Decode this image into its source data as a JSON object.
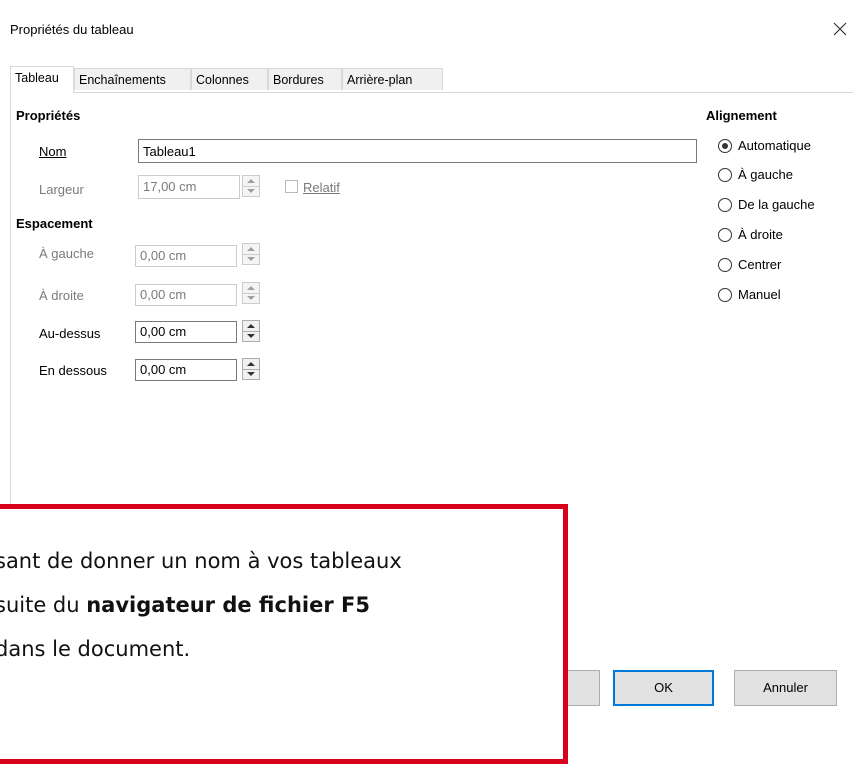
{
  "window": {
    "title": "Propriétés du tableau",
    "close_icon": "close-icon"
  },
  "tabs": [
    {
      "label": "Tableau",
      "active": true
    },
    {
      "label": "Enchaînements",
      "active": false
    },
    {
      "label": "Colonnes",
      "active": false
    },
    {
      "label": "Bordures",
      "active": false
    },
    {
      "label": "Arrière-plan",
      "active": false
    }
  ],
  "properties": {
    "header": "Propriétés",
    "nom_label": "Nom",
    "nom_value": "Tableau1",
    "largeur_label": "Largeur",
    "largeur_value": "17,00 cm",
    "relatif_label": "Relatif"
  },
  "spacing": {
    "header": "Espacement",
    "gauche_label": "À gauche",
    "gauche_value": "0,00 cm",
    "droite_label": "À droite",
    "droite_value": "0,00 cm",
    "dessus_label": "Au-dessus",
    "dessus_value": "0,00 cm",
    "dessous_label": "En dessous",
    "dessous_value": "0,00 cm"
  },
  "alignment": {
    "header": "Alignement",
    "options": [
      {
        "label": "Automatique",
        "checked": true
      },
      {
        "label": "À gauche",
        "checked": false
      },
      {
        "label": "De la gauche",
        "checked": false
      },
      {
        "label": "À droite",
        "checked": false
      },
      {
        "label": "Centrer",
        "checked": false
      },
      {
        "label": "Manuel",
        "checked": false
      }
    ]
  },
  "buttons": {
    "ok": "OK",
    "cancel": "Annuler"
  },
  "callout": {
    "line1": "sant de donner un nom à vos tableaux",
    "line2_pre": "suite du ",
    "line2_bold": "navigateur de fichier F5",
    "line3": "dans le document."
  },
  "colors": {
    "callout_border": "#d9001b",
    "default_button_border": "#0078d7"
  }
}
